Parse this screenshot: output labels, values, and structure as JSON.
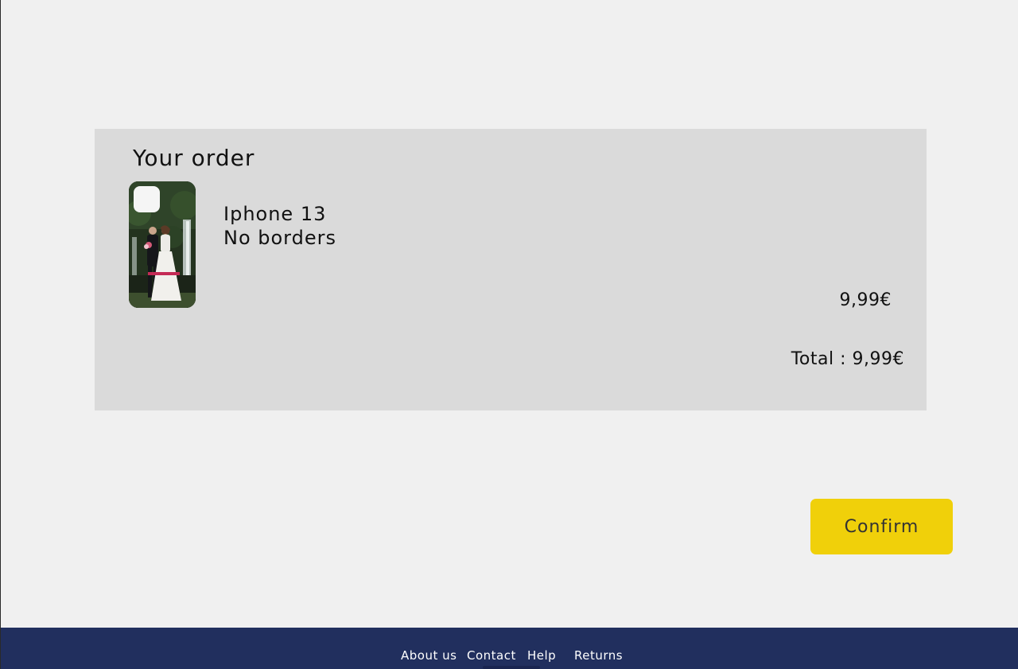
{
  "order": {
    "title": "Your order",
    "item": {
      "name": "Iphone 13",
      "variant": "No borders",
      "price": "9,99€",
      "image": "wedding-photo-phone-case"
    },
    "total": "Total : 9,99€"
  },
  "actions": {
    "confirm_label": "Confirm"
  },
  "footer": {
    "links": [
      {
        "label": "About us"
      },
      {
        "label": "Contact"
      },
      {
        "label": "Help"
      },
      {
        "label": "Returns"
      }
    ]
  },
  "colors": {
    "page_background": "#f0f0f0",
    "panel_background": "#dadada",
    "confirm_button": "#f0d00a",
    "footer_background": "#212f5e"
  }
}
